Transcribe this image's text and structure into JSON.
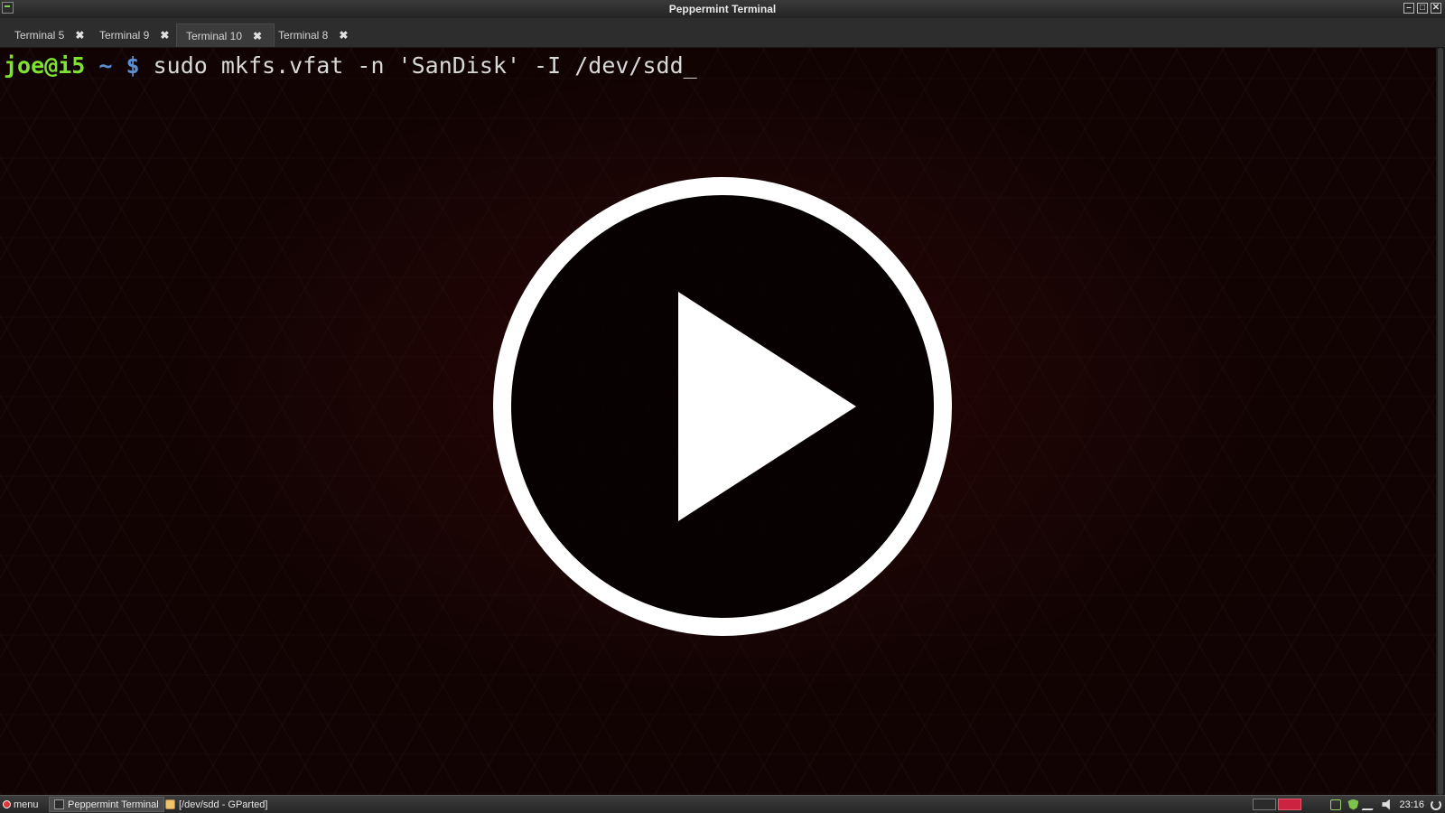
{
  "window": {
    "title": "Peppermint Terminal"
  },
  "tabs": [
    {
      "label": "Terminal 5",
      "active": false
    },
    {
      "label": "Terminal 9",
      "active": false
    },
    {
      "label": "Terminal 10",
      "active": true
    },
    {
      "label": "Terminal 8",
      "active": false
    }
  ],
  "terminal": {
    "prompt_user": "joe@i5",
    "prompt_dir": "~",
    "prompt_symbol": "$",
    "command": "sudo mkfs.vfat -n 'SanDisk' -I /dev/sdd",
    "cursor": "_",
    "colors": {
      "user": "#7fe231",
      "path": "#5a8fd6",
      "text": "#d8d8d8",
      "background": "#110303"
    }
  },
  "overlay": {
    "icon": "play-icon"
  },
  "taskbar": {
    "menu_label": "menu",
    "tasks": [
      {
        "label": "Peppermint Terminal",
        "icon": "terminal-icon",
        "active": true
      },
      {
        "label": "[/dev/sdd - GParted]",
        "icon": "gparted-icon",
        "active": false
      }
    ],
    "workspaces": 2,
    "current_workspace": 2,
    "clock": "23:16",
    "accent": "#cc2440"
  }
}
